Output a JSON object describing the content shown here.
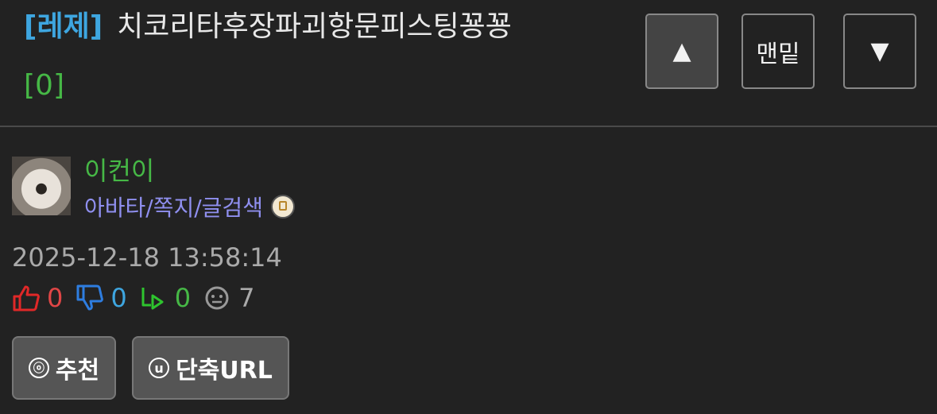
{
  "post": {
    "tag": "[레제]",
    "title": "치코리타후장파괴항문피스팅꾱꾱",
    "comment_count": "[0]"
  },
  "nav": {
    "up_label": "▲",
    "bottom_label": "맨밑",
    "down_label": "▼"
  },
  "author": {
    "name": "이컨이",
    "links": "아바타/쪽지/글검색"
  },
  "date": "2025-12-18 13:58:14",
  "stats": {
    "upvotes": "0",
    "downvotes": "0",
    "shares": "0",
    "views": "7"
  },
  "actions": {
    "recommend_glyph": "ⓞ",
    "recommend_label": "추천",
    "shorturl_glyph": "u",
    "shorturl_label": "단축URL"
  },
  "colors": {
    "background": "#222222",
    "tag": "#3ea6e0",
    "comment_count": "#46b846",
    "author": "#46b846",
    "links": "#8f8fef",
    "upvote": "#e04646",
    "downvote": "#3ea6e0",
    "share": "#46b846"
  }
}
